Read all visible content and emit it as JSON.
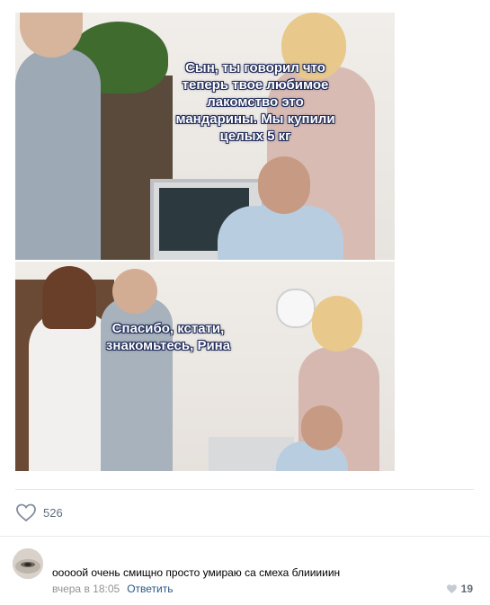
{
  "post": {
    "caption_top": "Сын, ты говорил что теперь твое любимое лакомство это мандарины. Мы купили целых 5 кг",
    "caption_bottom": "Спасибо, кстати, знакомьтесь, Рина"
  },
  "likes": {
    "icon": "heart-icon",
    "count": "526"
  },
  "comment": {
    "text": "oooooй очень смищно просто умираю са смеха блииииин",
    "time": "вчера в 18:05",
    "reply_label": "Ответить",
    "like_icon": "heart-icon",
    "like_count": "19"
  },
  "colors": {
    "link": "#2a5885",
    "meta": "#939393",
    "icon": "#818c99"
  }
}
